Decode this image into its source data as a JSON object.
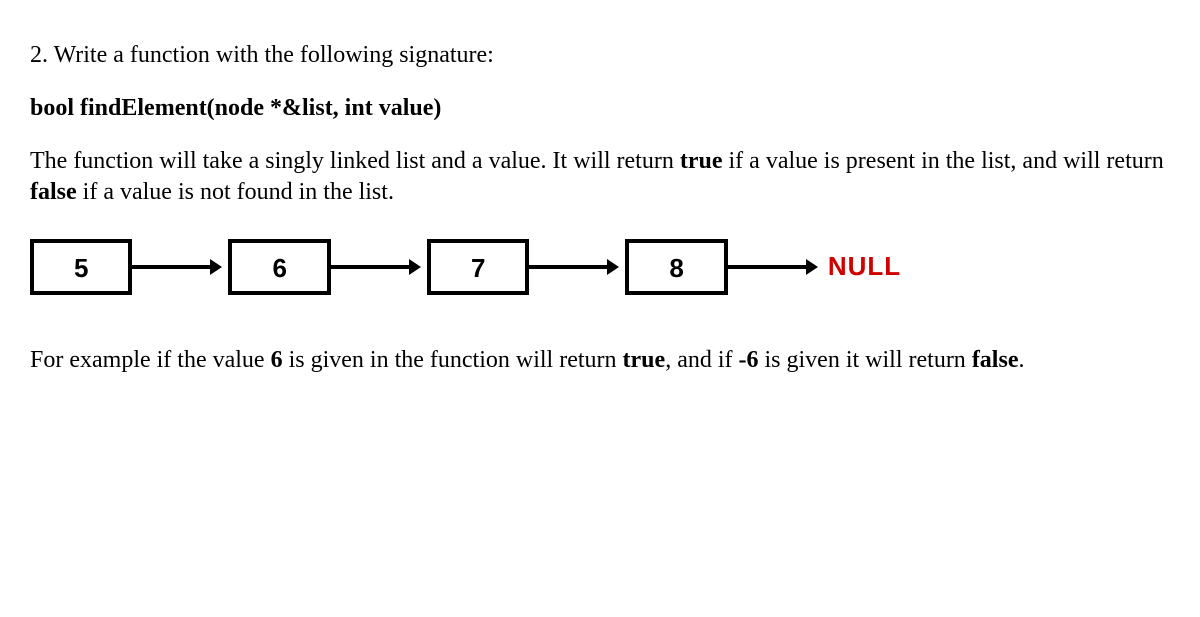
{
  "question": {
    "number": "2.",
    "prompt": "Write a function with the following signature:",
    "signature": "bool findElement(node *&list, int value)",
    "description_pre": "The function will take a singly linked list and a value. It will return ",
    "desc_true": "true",
    "desc_mid": " if a value is present in the list, and will return ",
    "desc_false": "false",
    "desc_post": " if a value is not found in the list.",
    "diagram": {
      "nodes": [
        "5",
        "6",
        "7",
        "8"
      ],
      "terminal": "NULL"
    },
    "example_pre": "For example if the value ",
    "example_v1": "6",
    "example_mid1": " is given in the function will return ",
    "example_true": "true",
    "example_mid2": ", and if ",
    "example_v2": "-6",
    "example_mid3": " is given it will return ",
    "example_false": "false",
    "example_post": "."
  }
}
